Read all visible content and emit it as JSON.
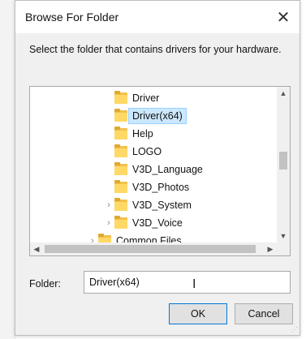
{
  "dialog": {
    "title": "Browse For Folder",
    "close_glyph": "✕",
    "instruction": "Select the folder that contains drivers for your hardware."
  },
  "tree": {
    "nodes": [
      {
        "label": "Driver",
        "expander": false,
        "selected": false
      },
      {
        "label": "Driver(x64)",
        "expander": false,
        "selected": true
      },
      {
        "label": "Help",
        "expander": false,
        "selected": false
      },
      {
        "label": "LOGO",
        "expander": false,
        "selected": false
      },
      {
        "label": "V3D_Language",
        "expander": false,
        "selected": false
      },
      {
        "label": "V3D_Photos",
        "expander": false,
        "selected": false
      },
      {
        "label": "V3D_System",
        "expander": true,
        "selected": false
      },
      {
        "label": "V3D_Voice",
        "expander": true,
        "selected": false
      },
      {
        "label": "Common Files",
        "expander": true,
        "selected": false
      }
    ],
    "expander_glyph": "›",
    "scroll_up": "▲",
    "scroll_down": "▼",
    "scroll_left": "◀",
    "scroll_right": "▶"
  },
  "folder_field": {
    "label": "Folder:",
    "value": "Driver(x64)"
  },
  "buttons": {
    "ok": "OK",
    "cancel": "Cancel"
  },
  "colors": {
    "selection_bg": "#cce8ff",
    "folder": "#ffd866",
    "ok_border": "#0078d7"
  }
}
